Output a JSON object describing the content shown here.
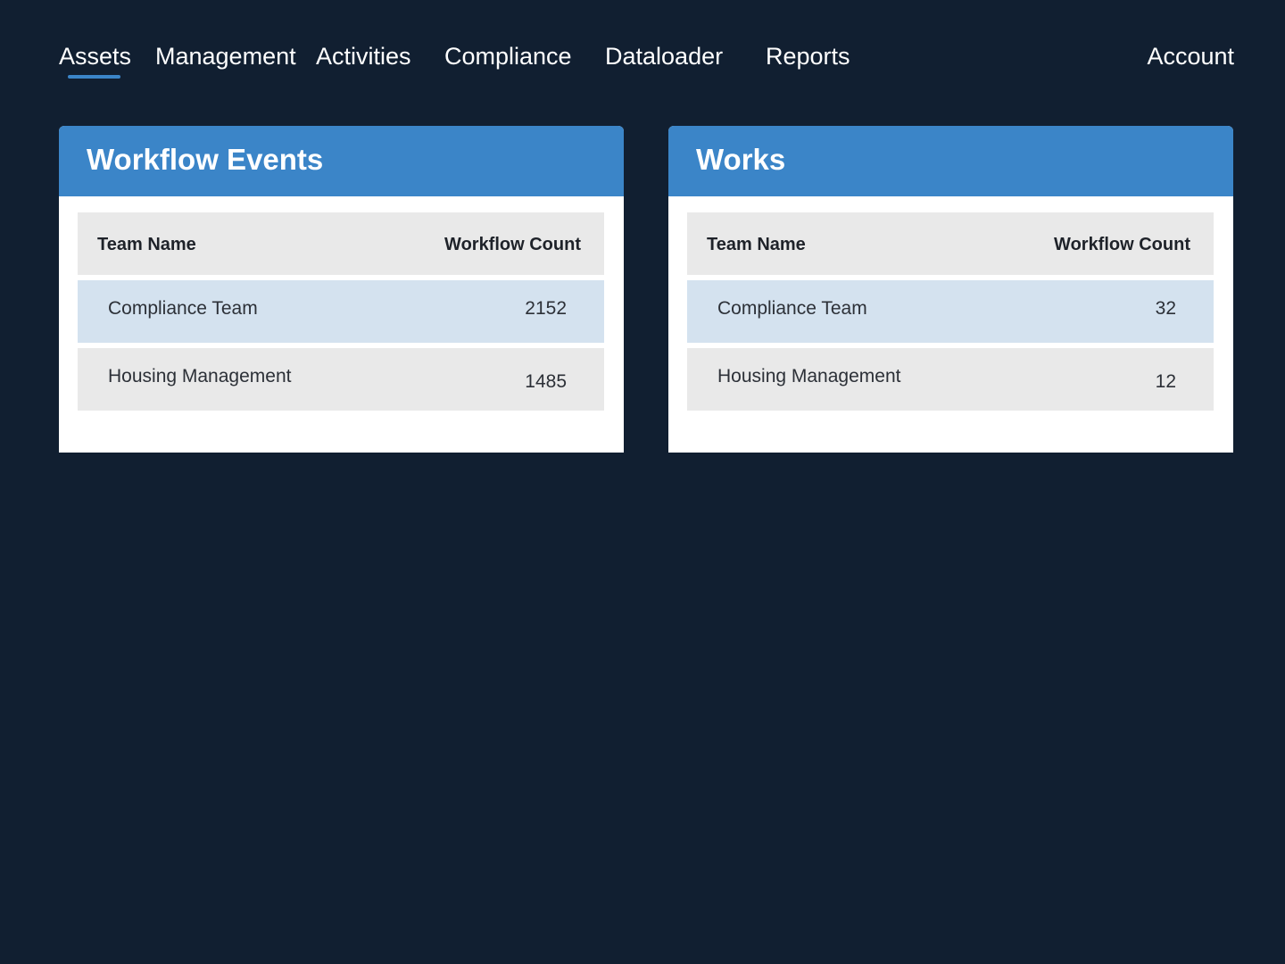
{
  "colors": {
    "background": "#111f31",
    "accent": "#3b85c8",
    "row_highlight": "#d4e2ef",
    "row_default": "#e9e9e9"
  },
  "nav": {
    "items": [
      {
        "label": "Assets",
        "active": true
      },
      {
        "label": "Management"
      },
      {
        "label": "Activities"
      },
      {
        "label": "Compliance"
      },
      {
        "label": "Dataloader"
      },
      {
        "label": "Reports"
      }
    ],
    "account": "Account"
  },
  "panels": [
    {
      "title": "Workflow Events",
      "columns": [
        "Team Name",
        "Workflow Count"
      ],
      "rows": [
        {
          "team": "Compliance Team",
          "count": "2152"
        },
        {
          "team": "Housing Management",
          "count": "1485"
        }
      ]
    },
    {
      "title": "Works",
      "columns": [
        "Team Name",
        "Workflow Count"
      ],
      "rows": [
        {
          "team": "Compliance Team",
          "count": "32"
        },
        {
          "team": "Housing Management",
          "count": "12"
        }
      ]
    }
  ]
}
